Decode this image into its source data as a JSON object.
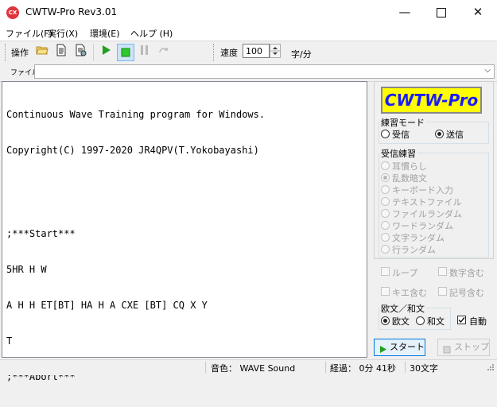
{
  "window": {
    "title": "CWTW-Pro Rev3.01",
    "icon_text": "CX",
    "icons": [
      "minimize-icon",
      "maximize-icon",
      "close-icon"
    ]
  },
  "menu": [
    "ファイル(F)",
    "実行(X)",
    "環境(E)",
    "ヘルプ (H)"
  ],
  "toolbar": {
    "operate_label": "操作",
    "icons": [
      "open-folder-icon",
      "document-icon",
      "document-settings-icon",
      "play-icon",
      "stop-icon",
      "pause-icon",
      "repeat-icon"
    ],
    "speed_label": "速度",
    "speed_value": "100",
    "speed_unit": "字/分"
  },
  "file_row": {
    "label": "ファイル",
    "value": ""
  },
  "text_area": {
    "lines": [
      "Continuous Wave Training program for Windows.",
      "Copyright(C) 1997-2020 JR4QPV(T.Yokobayashi)",
      "",
      "",
      ";***Start***",
      "5HR H W",
      "A H H ET[BT] HA H A CXE [BT] CQ X Y",
      "T",
      ";***Abort***"
    ]
  },
  "logo": "CWTW-Pro",
  "practice_mode": {
    "title": "練習モード",
    "options": [
      {
        "label": "受信",
        "selected": false
      },
      {
        "label": "送信",
        "selected": true
      }
    ]
  },
  "receive_practice": {
    "title": "受信練習",
    "options": [
      {
        "label": "耳慣らし",
        "selected": false
      },
      {
        "label": "乱数暗文",
        "selected": true
      },
      {
        "label": "キーボード入力",
        "selected": false
      },
      {
        "label": "テキストファイル",
        "selected": false
      },
      {
        "label": "ファイルランダム",
        "selected": false
      },
      {
        "label": "ワードランダム",
        "selected": false
      },
      {
        "label": "文字ランダム",
        "selected": false
      },
      {
        "label": "行ランダム",
        "selected": false
      }
    ]
  },
  "checks": {
    "loop": {
      "label": "ループ",
      "checked": false
    },
    "number": {
      "label": "数字含む",
      "checked": false
    },
    "kigo": {
      "label": "キエ含む",
      "checked": false
    },
    "symbol": {
      "label": "記号含む",
      "checked": false
    }
  },
  "lang": {
    "title": "欧文／和文",
    "options": [
      {
        "label": "欧文",
        "selected": true
      },
      {
        "label": "和文",
        "selected": false
      }
    ],
    "auto": {
      "label": "自動",
      "checked": true
    }
  },
  "buttons": {
    "start": "スタート",
    "stop": "ストップ"
  },
  "status": {
    "sound": "音色： WAVE Sound",
    "elapsed": "経過： 0分 41秒",
    "count": "30文字"
  },
  "colors": {
    "logo_bg": "#ffff00",
    "logo_text": "#1a1aff",
    "play_green": "#20a020",
    "app_icon": "#e0333b"
  }
}
